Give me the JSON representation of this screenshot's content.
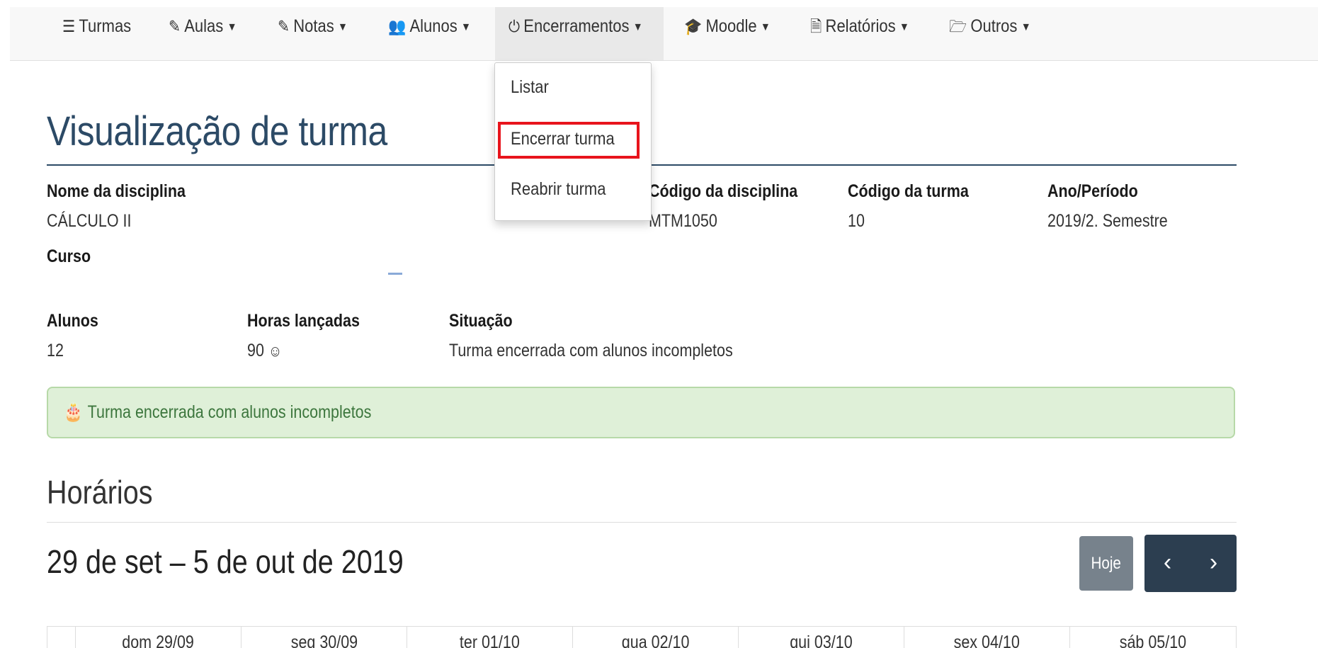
{
  "nav": {
    "items": [
      {
        "label": "Turmas",
        "icon": "list-icon",
        "glyph": "☰",
        "caret": false
      },
      {
        "label": "Aulas",
        "icon": "pencil-icon",
        "glyph": "✎",
        "caret": true
      },
      {
        "label": "Notas",
        "icon": "pencil-icon",
        "glyph": "✎",
        "caret": true
      },
      {
        "label": "Alunos",
        "icon": "users-icon",
        "glyph": "👥",
        "caret": true
      },
      {
        "label": "Encerramentos",
        "icon": "power-icon",
        "glyph": "⏻",
        "caret": true
      },
      {
        "label": "Moodle",
        "icon": "graduation-cap-icon",
        "glyph": "🎓",
        "caret": true
      },
      {
        "label": "Relatórios",
        "icon": "file-icon",
        "glyph": "🗎",
        "caret": true
      },
      {
        "label": "Outros",
        "icon": "folder-open-icon",
        "glyph": "🗁",
        "caret": true
      }
    ],
    "caret_glyph": "▼"
  },
  "dropdown": {
    "items": [
      "Listar",
      "Encerrar turma",
      "Reabrir turma"
    ],
    "highlight_color": "#e8141c"
  },
  "page": {
    "title": "Visualização de turma",
    "title_color": "#2c4a66"
  },
  "info": {
    "disciplina_label": "Nome da disciplina",
    "disciplina_value": "CÁLCULO II",
    "codigo_disciplina_label": "Código da disciplina",
    "codigo_disciplina_value": "MTM1050",
    "codigo_turma_label": "Código da turma",
    "codigo_turma_value": "10",
    "ano_periodo_label": "Ano/Período",
    "ano_periodo_value": "2019/2. Semestre",
    "curso_label": "Curso",
    "alunos_label": "Alunos",
    "alunos_value": "12",
    "horas_label": "Horas lançadas",
    "horas_value": "90",
    "horas_icon": "smile-icon",
    "situacao_label": "Situação",
    "situacao_value": "Turma encerrada com alunos incompletos"
  },
  "alert": {
    "icon": "birthday-cake-icon",
    "text": "Turma encerrada com alunos incompletos",
    "bg_color": "#dff0d8",
    "text_color": "#3c763d"
  },
  "horarios": {
    "heading": "Horários",
    "week_range": "29 de set – 5 de out de 2019",
    "today_button": "Hoje",
    "prev_glyph": "‹",
    "next_glyph": "›",
    "days": [
      "dom 29/09",
      "seg 30/09",
      "ter 01/10",
      "qua 02/10",
      "qui 03/10",
      "sex 04/10",
      "sáb 05/10"
    ]
  }
}
